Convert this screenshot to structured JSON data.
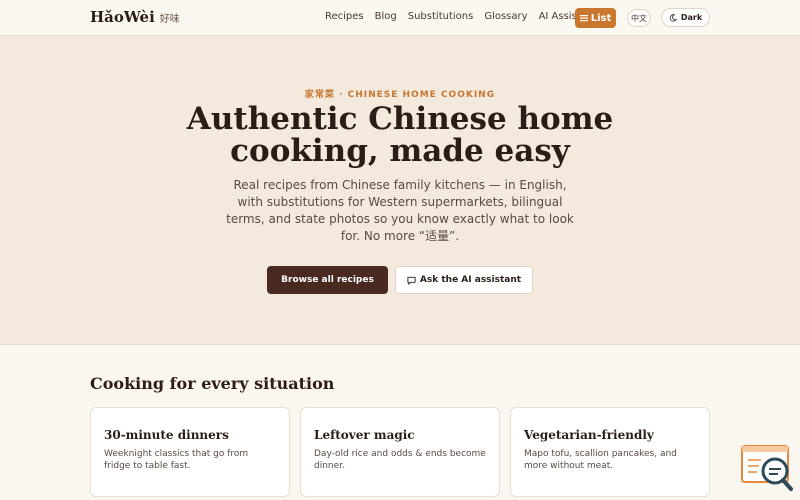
{
  "header": {
    "logo": "HǎoWèi",
    "logo_sub": "好味",
    "nav": [
      "Recipes",
      "Blog",
      "Substitutions",
      "Glossary",
      "AI Assistant"
    ],
    "list_icon": "list-icon",
    "list_label": "List",
    "lang_label": "中文",
    "dark_icon": "moon-icon",
    "dark_label": "Dark"
  },
  "hero": {
    "eyebrow": "家常菜 · CHINESE HOME COOKING",
    "title": "Authentic Chinese home cooking, made easy",
    "description": "Real recipes from Chinese family kitchens — in English, with substitutions for Western supermarkets, bilingual terms, and state photos so you know exactly what to look for. No more “适量”.",
    "browse_label": "Browse all recipes",
    "ai_icon": "chat-icon",
    "ai_label": "Ask the AI assistant"
  },
  "situations": {
    "title": "Cooking for every situation",
    "cards": [
      {
        "title": "30-minute dinners",
        "desc": "Weeknight classics that go from fridge to table fast."
      },
      {
        "title": "Leftover magic",
        "desc": "Day-old rice and odds & ends become dinner."
      },
      {
        "title": "Vegetarian-friendly",
        "desc": "Mapo tofu, scallion pancakes, and more without meat."
      }
    ]
  },
  "widget": {
    "icon": "search-document-icon"
  },
  "colors": {
    "accent": "#c9762f",
    "dark_button": "#4a2a20",
    "hero_bg": "#f3e9dd"
  }
}
